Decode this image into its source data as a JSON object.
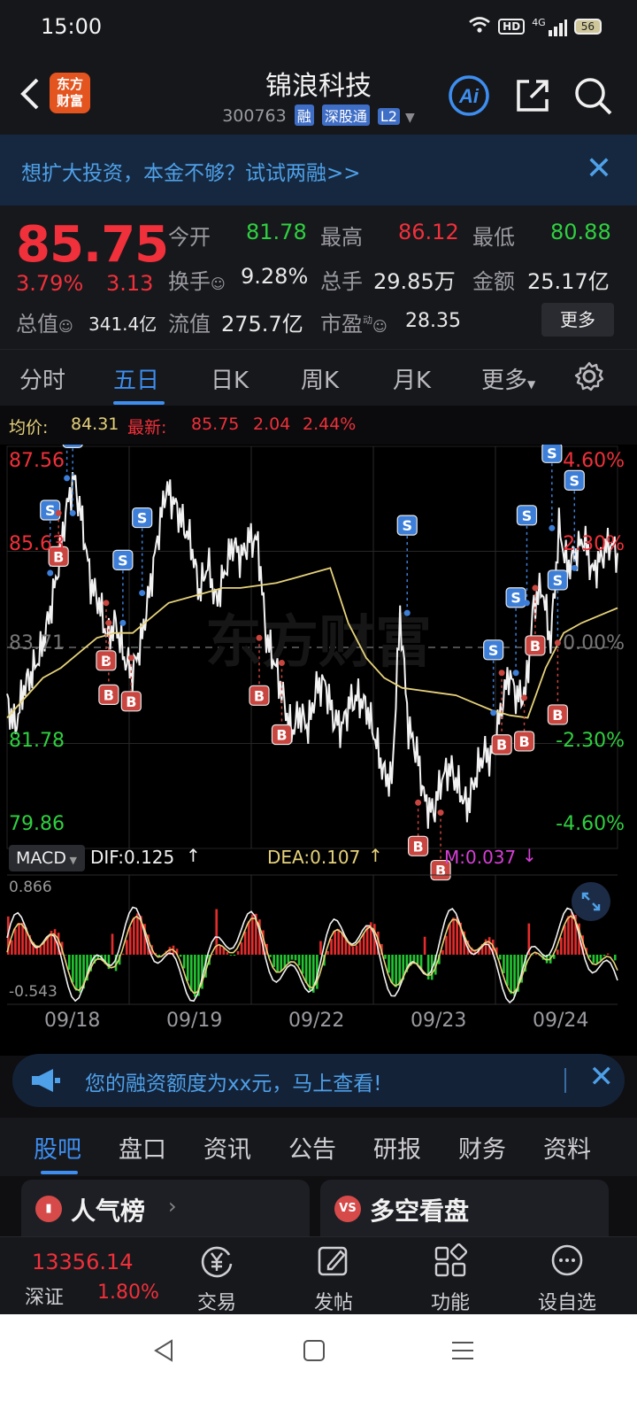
{
  "status": {
    "time": "15:00",
    "hd": "HD",
    "net": "4G",
    "battery": "56"
  },
  "header": {
    "logo_line1": "东方",
    "logo_line2": "财富",
    "name": "锦浪科技",
    "code": "300763",
    "tags": [
      "融",
      "深股通",
      "L2"
    ],
    "icons": [
      "back-icon",
      "ai-icon",
      "share-icon",
      "search-icon"
    ]
  },
  "promo": {
    "text": "想扩大投资，本金不够？试试两融>>"
  },
  "quote": {
    "price": "85.75",
    "pct": "3.79%",
    "chg": "3.13",
    "open_label": "今开",
    "open": "81.78",
    "high_label": "最高",
    "high": "86.12",
    "low_label": "最低",
    "low": "80.88",
    "turnover_label": "换手",
    "turnover": "9.28%",
    "volume_label": "总手",
    "volume": "29.85万",
    "amount_label": "金额",
    "amount": "25.17亿",
    "mcap_label": "总值",
    "mcap": "341.4亿",
    "float_label": "流值",
    "float": "275.7亿",
    "pe_label": "市盈",
    "pe_sup": "动",
    "pe": "28.35",
    "more": "更多"
  },
  "chart_tabs": [
    "分时",
    "五日",
    "日K",
    "周K",
    "月K",
    "更多"
  ],
  "avg": {
    "avg_label": "均价:",
    "avg": "84.31",
    "latest_label": "最新:",
    "latest": "85.75",
    "chg": "2.04",
    "pct": "2.44%"
  },
  "chart_data": {
    "type": "line",
    "title": "",
    "y_left": [
      "87.56",
      "85.63",
      "83.71",
      "81.78",
      "79.86"
    ],
    "y_right": [
      "4.60%",
      "2.30%",
      "0.00%",
      "-2.30%",
      "-4.60%"
    ],
    "ylim": [
      79.86,
      87.56
    ],
    "base": 83.71,
    "days": [
      "09/18",
      "09/19",
      "09/22",
      "09/23",
      "09/24"
    ],
    "series": [
      {
        "name": "",
        "color": "#f2f2f2",
        "values": [
          82.6,
          82.1,
          82.9,
          83.2,
          83.6,
          84.3,
          85.2,
          86.4,
          87.1,
          86.2,
          85.0,
          84.6,
          83.9,
          84.2,
          83.5,
          83.2,
          83.8,
          84.8,
          85.9,
          86.9,
          86.6,
          86.2,
          85.8,
          84.8,
          85.4,
          84.6,
          85.2,
          85.8,
          85.5,
          85.9,
          85.8,
          83.9,
          83.4,
          82.7,
          82.0,
          82.4,
          82.1,
          82.9,
          83.0,
          82.3,
          82.1,
          82.6,
          82.7,
          82.5,
          81.9,
          81.2,
          81.0,
          84.4,
          82.1,
          81.6,
          80.6,
          80.4,
          81.1,
          81.3,
          80.9,
          80.5,
          81.1,
          81.6,
          81.5,
          82.4,
          83.2,
          82.7,
          82.8,
          84.6,
          84.9,
          83.8,
          86.1,
          85.3,
          85.6,
          85.9,
          85.2,
          85.5,
          85.8,
          85.6
        ]
      },
      {
        "name": "均价",
        "color": "#e6d27a",
        "values": [
          82.3,
          82.7,
          83.1,
          83.3,
          83.6,
          83.9,
          84.0,
          84.0,
          84.3,
          84.6,
          84.7,
          84.8,
          84.9,
          84.9,
          84.95,
          85.0,
          85.1,
          85.2,
          85.3,
          84.2,
          83.5,
          83.1,
          82.9,
          82.85,
          82.8,
          82.75,
          82.6,
          82.45,
          82.35,
          82.3,
          83.3,
          84.0,
          84.2,
          84.35,
          84.5
        ]
      }
    ],
    "signals": {
      "S": [
        [
          6,
          "S"
        ],
        [
          7,
          "S"
        ],
        [
          8,
          "S"
        ],
        [
          13,
          "S"
        ],
        [
          17,
          "S"
        ],
        [
          47,
          "S"
        ],
        [
          59,
          "S"
        ],
        [
          60,
          "S"
        ],
        [
          63,
          "S"
        ],
        [
          65,
          "S"
        ],
        [
          66,
          "S"
        ],
        [
          67,
          "S"
        ]
      ],
      "B": [
        [
          7,
          "B"
        ],
        [
          11,
          "B"
        ],
        [
          13,
          "B"
        ],
        [
          14,
          "B"
        ],
        [
          31,
          "B"
        ],
        [
          32,
          "B"
        ],
        [
          50,
          "B"
        ],
        [
          51,
          "B"
        ],
        [
          60,
          "B"
        ],
        [
          61,
          "B"
        ],
        [
          64,
          "B"
        ],
        [
          65,
          "B"
        ]
      ]
    },
    "macd": {
      "label": "MACD",
      "dif_label": "DIF:0.125",
      "dea_label": "DEA:0.107",
      "m_label": "M:0.037",
      "ymax": "0.866",
      "ymin": "-0.543"
    }
  },
  "tip": {
    "text": "您的融资额度为xx元，马上查看!"
  },
  "bottom_tabs": [
    "股吧",
    "盘口",
    "资讯",
    "公告",
    "研报",
    "财务",
    "资料"
  ],
  "cards": [
    {
      "icon": "chart-icon",
      "label": "人气榜"
    },
    {
      "icon": "vs-icon",
      "label": "多空看盘"
    }
  ],
  "index": {
    "value": "13356.14",
    "name": "深证",
    "pct": "1.80%"
  },
  "nav": [
    "交易",
    "发帖",
    "功能",
    "设自选"
  ]
}
